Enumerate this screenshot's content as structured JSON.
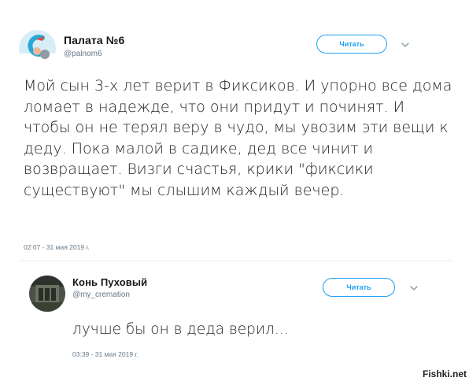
{
  "tweets": [
    {
      "author_name": "Палата №6",
      "handle": "@palnom6",
      "follow_label": "Читать",
      "text": "Мой сын 3-х лет верит в Фиксиков. И упорно все дома ломает в надежде, что они придут и починят. И чтобы он не терял веру в чудо, мы увозим эти вещи к деду. Пока малой в садике, дед все чинит и возвращает. Визги счастья, крики \"фиксики существуют\" мы слышим каждый вечер.",
      "timestamp": "02:07 - 31 мая 2019 г."
    },
    {
      "author_name": "Конь Пуховый",
      "handle": "@my_cremation",
      "follow_label": "Читать",
      "text": "лучше бы он в деда верил...",
      "timestamp": "03:39 - 31 мая 2019 г."
    }
  ],
  "watermark": "Fishki.net",
  "colors": {
    "accent": "#1da1f2",
    "text": "#1c2022",
    "secondary": "#657786"
  }
}
